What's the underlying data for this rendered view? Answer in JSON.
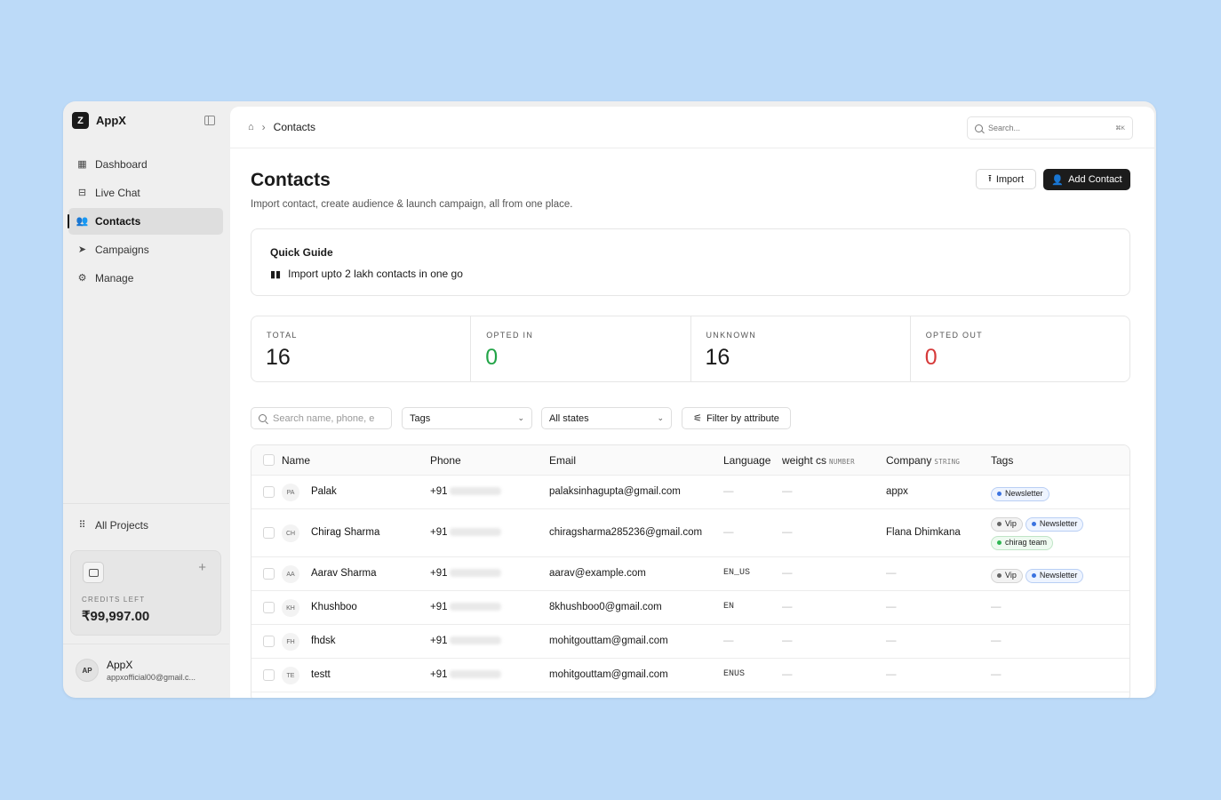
{
  "app": {
    "name": "AppX",
    "logo_letter": "Z"
  },
  "sidebar": {
    "items": [
      {
        "label": "Dashboard",
        "icon": "dashboard-icon",
        "glyph": "▦"
      },
      {
        "label": "Live Chat",
        "icon": "inbox-icon",
        "glyph": "⊟"
      },
      {
        "label": "Contacts",
        "icon": "users-icon",
        "glyph": "👥",
        "active": true
      },
      {
        "label": "Campaigns",
        "icon": "send-icon",
        "glyph": "➤"
      },
      {
        "label": "Manage",
        "icon": "gear-icon",
        "glyph": "⚙"
      }
    ],
    "all_projects": "All Projects",
    "credits": {
      "label": "CREDITS LEFT",
      "value": "₹99,997.00",
      "plus": "+"
    },
    "user": {
      "initials": "AP",
      "name": "AppX",
      "email": "appxofficial00@gmail.c..."
    }
  },
  "topbar": {
    "breadcrumb_sep": "›",
    "breadcrumb_current": "Contacts",
    "search_placeholder": "Search...",
    "search_shortcut": "⌘K"
  },
  "page": {
    "title": "Contacts",
    "subtitle": "Import contact, create audience & launch campaign, all from one place.",
    "import_label": "Import",
    "add_label": "Add Contact"
  },
  "quick_guide": {
    "title": "Quick Guide",
    "item": "Import upto 2 lakh contacts in one go"
  },
  "stats": [
    {
      "label": "TOTAL",
      "value": "16",
      "color": "#1a1a1a"
    },
    {
      "label": "OPTED IN",
      "value": "0",
      "color": "#22a447"
    },
    {
      "label": "UNKNOWN",
      "value": "16",
      "color": "#1a1a1a"
    },
    {
      "label": "OPTED OUT",
      "value": "0",
      "color": "#d63a3a"
    }
  ],
  "filters": {
    "search_placeholder": "Search name, phone, e",
    "tags_label": "Tags",
    "states_label": "All states",
    "attribute_label": "Filter by attribute"
  },
  "table": {
    "columns": {
      "name": "Name",
      "phone": "Phone",
      "email": "Email",
      "language": "Language",
      "weight": "weight cs",
      "weight_type": "NUMBER",
      "company": "Company",
      "company_type": "STRING",
      "tags": "Tags"
    },
    "rows": [
      {
        "initials": "PA",
        "name": "Palak",
        "phone": "+91",
        "email": "palaksinhagupta@gmail.com",
        "language": "—",
        "weight": "—",
        "company": "appx",
        "tags": [
          {
            "label": "Newsletter",
            "color": "blue"
          }
        ]
      },
      {
        "initials": "CH",
        "name": "Chirag Sharma",
        "phone": "+91",
        "email": "chiragsharma285236@gmail.com",
        "language": "—",
        "weight": "—",
        "company": "Flana Dhimkana",
        "tags": [
          {
            "label": "Vip",
            "color": "gray"
          },
          {
            "label": "Newsletter",
            "color": "blue"
          },
          {
            "label": "chirag team",
            "color": "green"
          }
        ]
      },
      {
        "initials": "AA",
        "name": "Aarav Sharma",
        "phone": "+91",
        "email": "aarav@example.com",
        "language": "EN_US",
        "weight": "—",
        "company": "—",
        "tags": [
          {
            "label": "Vip",
            "color": "gray"
          },
          {
            "label": "Newsletter",
            "color": "blue"
          }
        ]
      },
      {
        "initials": "KH",
        "name": "Khushboo",
        "phone": "+91",
        "email": "8khushboo0@gmail.com",
        "language": "EN",
        "weight": "—",
        "company": "—",
        "tags": []
      },
      {
        "initials": "FH",
        "name": "fhdsk",
        "phone": "+91",
        "email": "mohitgouttam@gmail.com",
        "language": "—",
        "weight": "—",
        "company": "—",
        "tags": []
      },
      {
        "initials": "TE",
        "name": "testt",
        "phone": "+91",
        "email": "mohitgouttam@gmail.com",
        "language": "ENUS",
        "weight": "—",
        "company": "—",
        "tags": []
      }
    ],
    "empty_tags": "—"
  },
  "colors": {
    "background": "#bcdaf8",
    "accent": "#1c1c1c",
    "tag_blue": "#3b73e0",
    "tag_green": "#2fb653",
    "tag_gray": "#666666"
  }
}
